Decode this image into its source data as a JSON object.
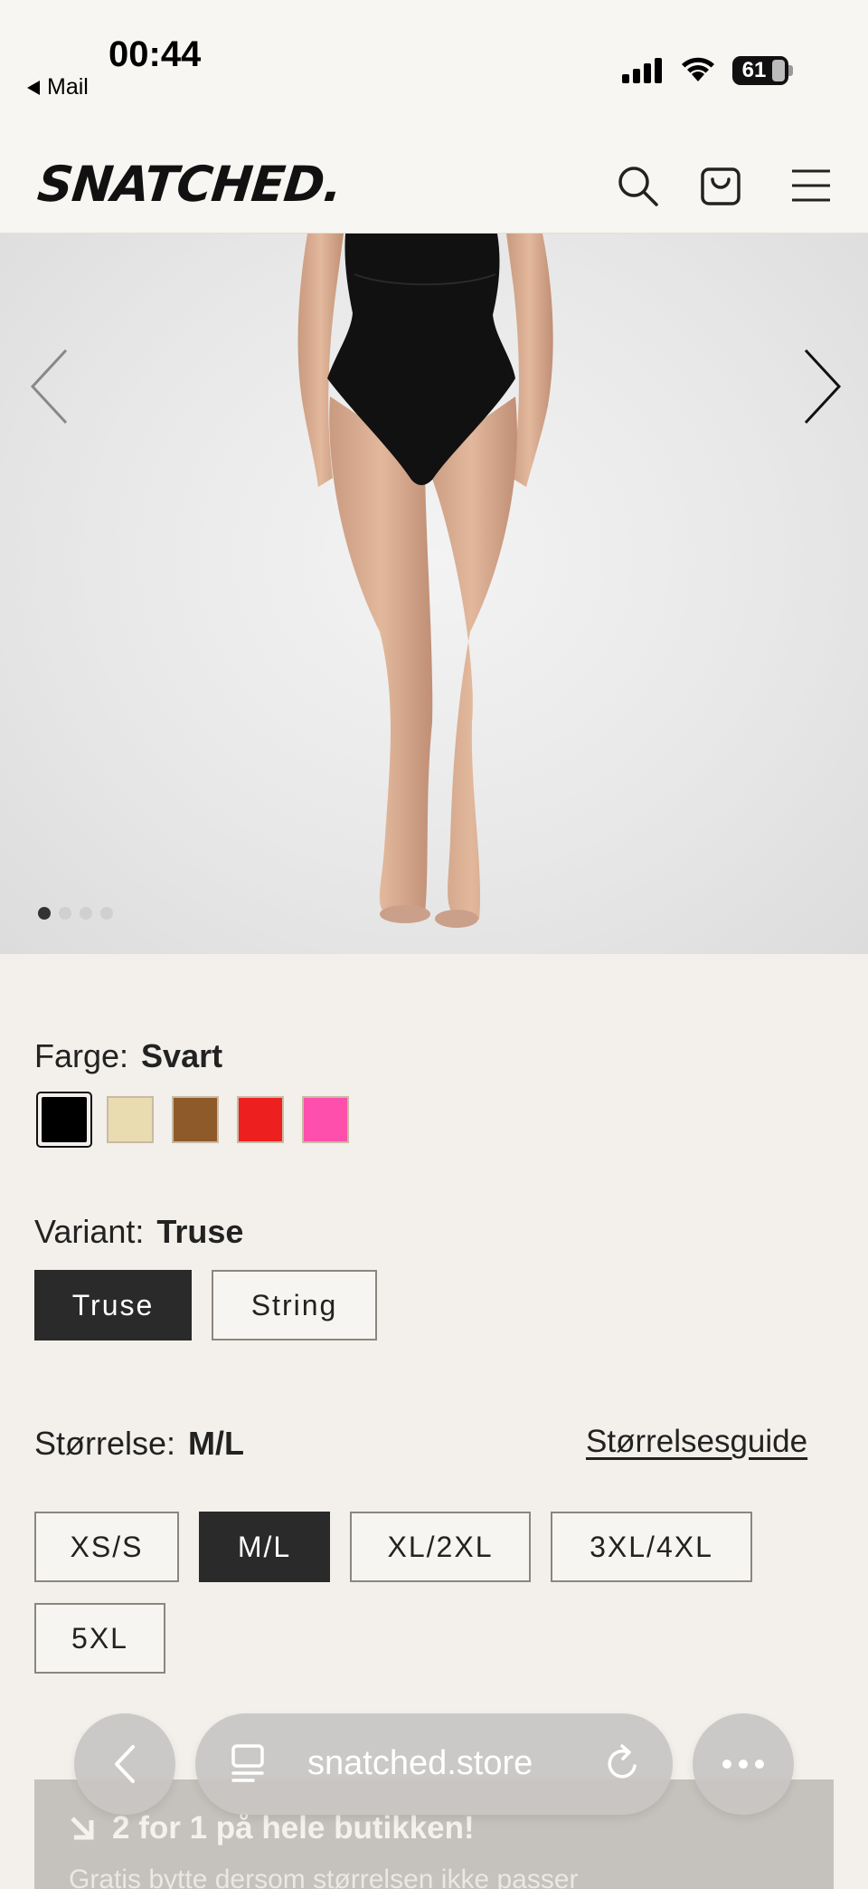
{
  "status_bar": {
    "time": "00:44",
    "back_label": "Mail",
    "battery": "61"
  },
  "header": {
    "logo": "SNATCHED.",
    "icons": [
      "search-icon",
      "cart-icon",
      "menu-icon"
    ]
  },
  "gallery": {
    "slide_count": 4,
    "active_slide": 1
  },
  "color": {
    "label": "Farge:",
    "value": "Svart",
    "swatches": [
      "#000000",
      "#e9dcb0",
      "#8f5a2a",
      "#ee1f1f",
      "#ff4fac"
    ]
  },
  "variant": {
    "label": "Variant:",
    "value": "Truse",
    "options": [
      "Truse",
      "String"
    ]
  },
  "size": {
    "label": "Størrelse:",
    "value": "M/L",
    "guide_link": "Størrelsesguide",
    "options": [
      "XS/S",
      "M/L",
      "XL/2XL",
      "3XL/4XL",
      "5XL"
    ]
  },
  "promo": {
    "title": "2 for 1 på hele butikken!",
    "subtitle": "Gratis bytte dersom størrelsen ikke passer"
  },
  "browser": {
    "url": "snatched.store"
  }
}
